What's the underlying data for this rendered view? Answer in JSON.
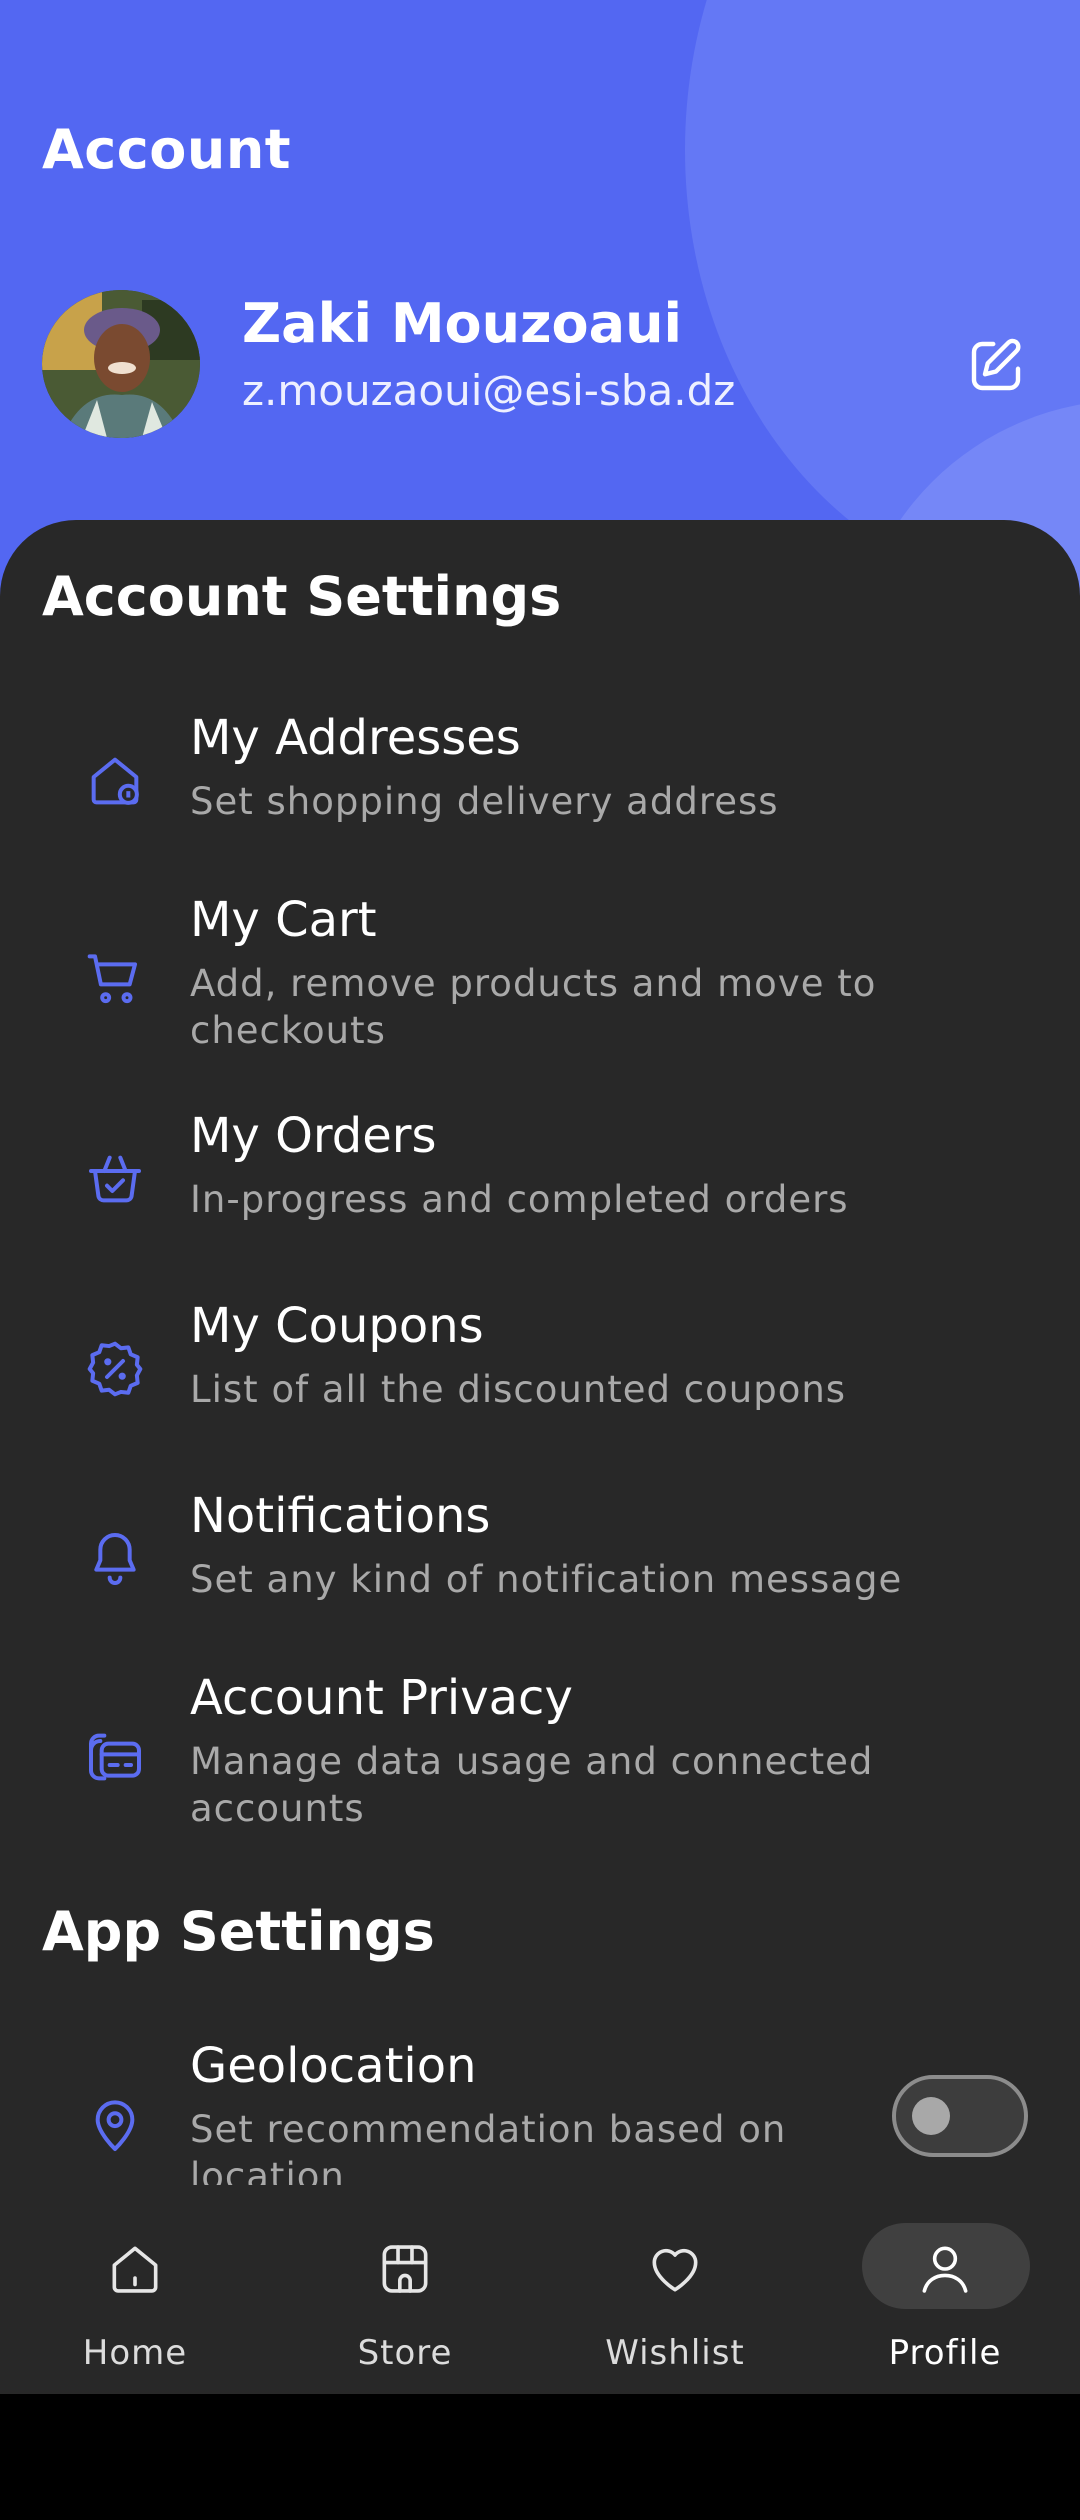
{
  "header": {
    "title": "Account",
    "user_name": "Zaki Mouzoaui",
    "user_email": "z.mouzaoui@esi-sba.dz"
  },
  "account_settings": {
    "title": "Account Settings",
    "items": [
      {
        "title": "My Addresses",
        "subtitle": "Set shopping delivery address",
        "icon": "home-location-icon"
      },
      {
        "title": "My Cart",
        "subtitle": "Add, remove products and move to checkouts",
        "icon": "cart-icon"
      },
      {
        "title": "My Orders",
        "subtitle": "In-progress and completed orders",
        "icon": "basket-check-icon"
      },
      {
        "title": "My Coupons",
        "subtitle": "List of all the discounted coupons",
        "icon": "discount-badge-icon"
      },
      {
        "title": "Notifications",
        "subtitle": "Set any kind of notification message",
        "icon": "bell-icon"
      },
      {
        "title": "Account Privacy",
        "subtitle": "Manage data usage and connected accounts",
        "icon": "security-card-icon"
      }
    ]
  },
  "app_settings": {
    "title": "App Settings",
    "items": [
      {
        "title": "Geolocation",
        "subtitle": "Set recommendation based on location",
        "icon": "location-pin-icon",
        "toggle_on": false
      }
    ]
  },
  "bottom_nav": {
    "items": [
      {
        "label": "Home",
        "icon": "home-icon",
        "active": false
      },
      {
        "label": "Store",
        "icon": "shop-icon",
        "active": false
      },
      {
        "label": "Wishlist",
        "icon": "heart-icon",
        "active": false
      },
      {
        "label": "Profile",
        "icon": "user-icon",
        "active": true
      }
    ]
  },
  "colors": {
    "accent": "#5367f2",
    "background": "#282828",
    "subtitle": "#a9a9a9"
  }
}
